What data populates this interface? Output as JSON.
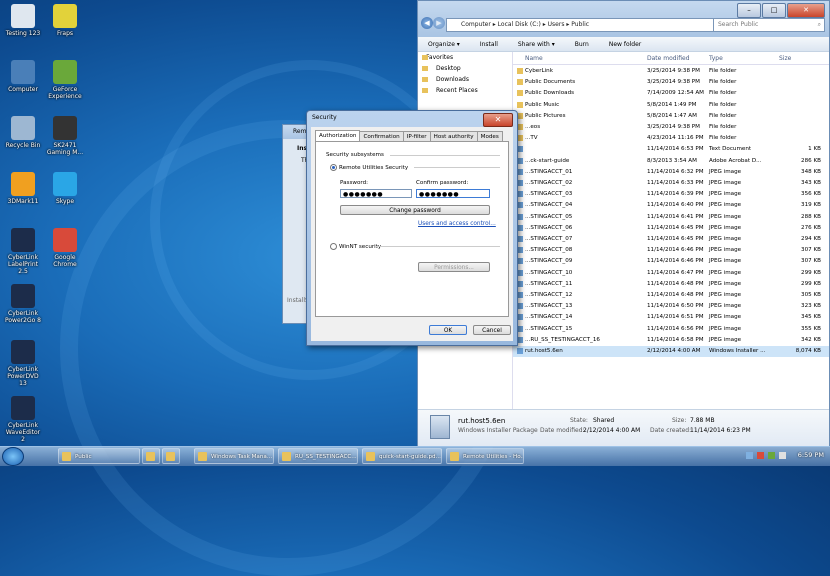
{
  "desktop": {
    "icons": [
      {
        "label": "Testing 123",
        "color": "#dfe7ef"
      },
      {
        "label": "Fraps",
        "color": "#e2d23a"
      },
      {
        "label": "Computer",
        "color": "#4a7fb8"
      },
      {
        "label": "GeForce Experience",
        "color": "#6aa83a"
      },
      {
        "label": "Recycle Bin",
        "color": "#9db7d2"
      },
      {
        "label": "SK2471 Gaming M...",
        "color": "#333"
      },
      {
        "label": "3DMark11",
        "color": "#f0a020"
      },
      {
        "label": "Skype",
        "color": "#2aa6e6"
      },
      {
        "label": "CyberLink LabelPrint 2.5",
        "color": "#1c2c4a"
      },
      {
        "label": "Google Chrome",
        "color": "#d84a3a"
      },
      {
        "label": "CyberLink Power2Go 8",
        "color": "#1c2c4a"
      },
      {
        "label": "CyberLink PowerDVD 13",
        "color": "#1c2c4a"
      },
      {
        "label": "CyberLink WaveEditor 2",
        "color": "#1c2c4a"
      }
    ]
  },
  "explorer": {
    "address": [
      "Computer",
      "Local Disk (C:)",
      "Users",
      "Public"
    ],
    "search_placeholder": "Search Public",
    "toolbar": [
      "Organize ▾",
      "Install",
      "Share with ▾",
      "Burn",
      "New folder"
    ],
    "nav": [
      "Favorites",
      "Desktop",
      "Downloads",
      "Recent Places"
    ],
    "columns": [
      "Name",
      "Date modified",
      "Type",
      "Size"
    ],
    "rows": [
      {
        "name": "CyberLink",
        "date": "3/25/2014 9:38 PM",
        "type": "File folder",
        "size": "",
        "kind": "folder"
      },
      {
        "name": "Public Documents",
        "date": "3/25/2014 9:38 PM",
        "type": "File folder",
        "size": "",
        "kind": "folder"
      },
      {
        "name": "Public Downloads",
        "date": "7/14/2009 12:54 AM",
        "type": "File folder",
        "size": "",
        "kind": "folder"
      },
      {
        "name": "Public Music",
        "date": "5/8/2014 1:49 PM",
        "type": "File folder",
        "size": "",
        "kind": "folder"
      },
      {
        "name": "Public Pictures",
        "date": "5/8/2014 1:47 AM",
        "type": "File folder",
        "size": "",
        "kind": "folder"
      },
      {
        "name": "...eos",
        "date": "3/25/2014 9:38 PM",
        "type": "File folder",
        "size": "",
        "kind": "folder"
      },
      {
        "name": "...TV",
        "date": "4/23/2014 11:16 PM",
        "type": "File folder",
        "size": "",
        "kind": "folder"
      },
      {
        "name": "",
        "date": "11/14/2014 6:53 PM",
        "type": "Text Document",
        "size": "1 KB",
        "kind": "img"
      },
      {
        "name": "...ck-start-guide",
        "date": "8/3/2013 3:54 AM",
        "type": "Adobe Acrobat D...",
        "size": "286 KB",
        "kind": "img"
      },
      {
        "name": "...STINGACCT_01",
        "date": "11/14/2014 6:32 PM",
        "type": "JPEG image",
        "size": "348 KB",
        "kind": "img"
      },
      {
        "name": "...STINGACCT_02",
        "date": "11/14/2014 6:33 PM",
        "type": "JPEG image",
        "size": "343 KB",
        "kind": "img"
      },
      {
        "name": "...STINGACCT_03",
        "date": "11/14/2014 6:39 PM",
        "type": "JPEG image",
        "size": "356 KB",
        "kind": "img"
      },
      {
        "name": "...STINGACCT_04",
        "date": "11/14/2014 6:40 PM",
        "type": "JPEG image",
        "size": "319 KB",
        "kind": "img"
      },
      {
        "name": "...STINGACCT_05",
        "date": "11/14/2014 6:41 PM",
        "type": "JPEG image",
        "size": "288 KB",
        "kind": "img"
      },
      {
        "name": "...STINGACCT_06",
        "date": "11/14/2014 6:45 PM",
        "type": "JPEG image",
        "size": "276 KB",
        "kind": "img"
      },
      {
        "name": "...STINGACCT_07",
        "date": "11/14/2014 6:45 PM",
        "type": "JPEG image",
        "size": "294 KB",
        "kind": "img"
      },
      {
        "name": "...STINGACCT_08",
        "date": "11/14/2014 6:46 PM",
        "type": "JPEG image",
        "size": "307 KB",
        "kind": "img"
      },
      {
        "name": "...STINGACCT_09",
        "date": "11/14/2014 6:46 PM",
        "type": "JPEG image",
        "size": "307 KB",
        "kind": "img"
      },
      {
        "name": "...STINGACCT_10",
        "date": "11/14/2014 6:47 PM",
        "type": "JPEG image",
        "size": "299 KB",
        "kind": "img"
      },
      {
        "name": "...STINGACCT_11",
        "date": "11/14/2014 6:48 PM",
        "type": "JPEG image",
        "size": "299 KB",
        "kind": "img"
      },
      {
        "name": "...STINGACCT_12",
        "date": "11/14/2014 6:48 PM",
        "type": "JPEG image",
        "size": "305 KB",
        "kind": "img"
      },
      {
        "name": "...STINGACCT_13",
        "date": "11/14/2014 6:50 PM",
        "type": "JPEG image",
        "size": "323 KB",
        "kind": "img"
      },
      {
        "name": "...STINGACCT_14",
        "date": "11/14/2014 6:51 PM",
        "type": "JPEG image",
        "size": "345 KB",
        "kind": "img"
      },
      {
        "name": "...STINGACCT_15",
        "date": "11/14/2014 6:56 PM",
        "type": "JPEG image",
        "size": "355 KB",
        "kind": "img"
      },
      {
        "name": "...RU_SS_TESTINGACCT_16",
        "date": "11/14/2014 6:58 PM",
        "type": "JPEG image",
        "size": "342 KB",
        "kind": "img"
      },
      {
        "name": "rut.host5.6en",
        "date": "2/12/2014 4:00 AM",
        "type": "Windows Installer ...",
        "size": "8,074 KB",
        "kind": "img",
        "selected": true
      }
    ],
    "details": {
      "name": "rut.host5.6en",
      "kind": "Windows Installer Package",
      "state_label": "State:",
      "state": "Shared",
      "size_label": "Size:",
      "size": "7.88 MB",
      "modified_label": "Date modified:",
      "modified": "2/12/2014 4:00 AM",
      "created_label": "Date created:",
      "created": "11/14/2014 6:23 PM"
    }
  },
  "behind_dialog": {
    "title": "Remo...",
    "frag1": "Insta...",
    "frag2": "The...",
    "frag3": "InstallS..."
  },
  "security": {
    "title": "Security",
    "tabs": [
      "Authorization",
      "Confirmation",
      "IP-filter",
      "Host authority",
      "Modes"
    ],
    "group_label": "Security subsystems",
    "option1": "Remote Utilities Security",
    "password_label": "Password:",
    "confirm_label": "Confirm password:",
    "password_value": "●●●●●●●",
    "confirm_value": "●●●●●●●",
    "change_password": "Change password",
    "users_link": "Users and access control...",
    "option2": "WinNT security",
    "permissions": "Permissions...",
    "ok": "OK",
    "cancel": "Cancel"
  },
  "taskbar": {
    "items": [
      "Public",
      "",
      "",
      "Windows Task Mana...",
      "RU_SS_TESTINGACC...",
      "quick-start-guide.pd...",
      "Remote Utilities - Ho..."
    ],
    "time": "6:59 PM"
  }
}
